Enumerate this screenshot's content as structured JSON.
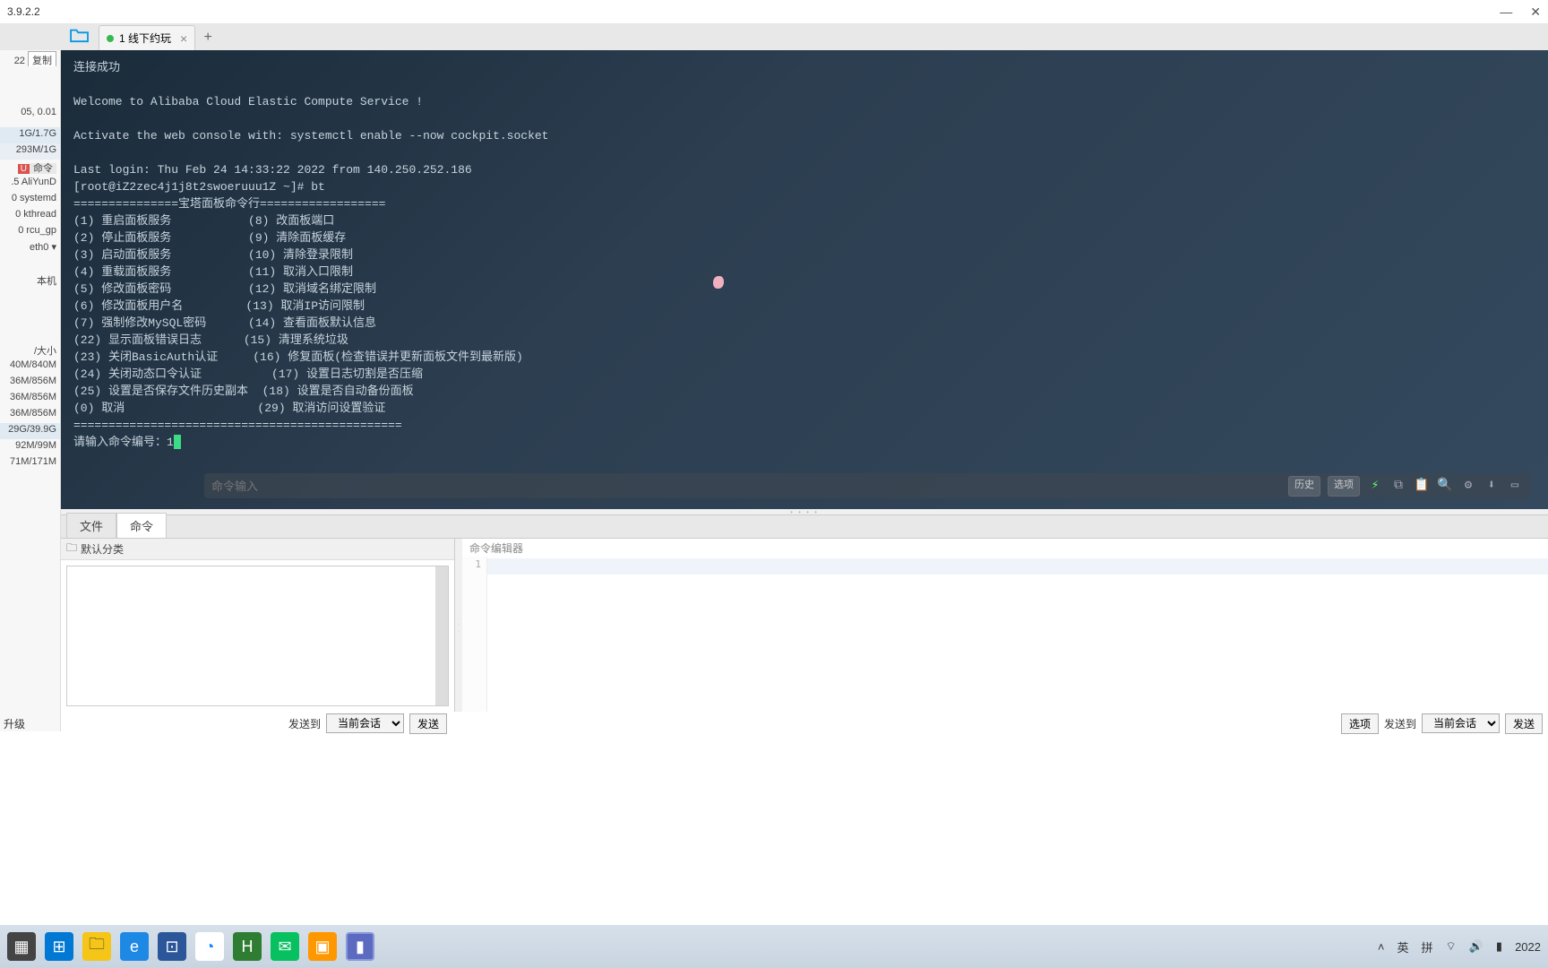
{
  "title_bar": {
    "version": "3.9.2.2"
  },
  "window_controls": {
    "min": "—",
    "close": "✕"
  },
  "tab": {
    "label": "1 线下约玩",
    "close": "×",
    "new": "+"
  },
  "side": {
    "num22": "22",
    "copy": "复制",
    "load": "05, 0.01",
    "mem1": "1G/1.7G",
    "mem2": "293M/1G",
    "cmd_badge": "U",
    "cmd_text": "命令",
    "p1": ".5 AliYunD",
    "p2": "0 systemd",
    "p3": "0 kthread",
    "p4": "0 rcu_gp",
    "iface": "eth0 ▾",
    "local": "本机",
    "sizes_hdr": "/大小",
    "s1": "40M/840M",
    "s2": "36M/856M",
    "s3": "36M/856M",
    "s4": "36M/856M",
    "s5": "29G/39.9G",
    "s6": "92M/99M",
    "s7": "71M/171M",
    "upgrade": "升级"
  },
  "terminal": {
    "lines": "连接成功\n\nWelcome to Alibaba Cloud Elastic Compute Service !\n\nActivate the web console with: systemctl enable --now cockpit.socket\n\nLast login: Thu Feb 24 14:33:22 2022 from 140.250.252.186\n[root@iZ2zec4j1j8t2swoeruuu1Z ~]# bt\n===============宝塔面板命令行==================\n(1) 重启面板服务           (8) 改面板端口\n(2) 停止面板服务           (9) 清除面板缓存\n(3) 启动面板服务           (10) 清除登录限制\n(4) 重载面板服务           (11) 取消入口限制\n(5) 修改面板密码           (12) 取消域名绑定限制\n(6) 修改面板用户名         (13) 取消IP访问限制\n(7) 强制修改MySQL密码      (14) 查看面板默认信息\n(22) 显示面板错误日志      (15) 清理系统垃圾\n(23) 关闭BasicAuth认证     (16) 修复面板(检查错误并更新面板文件到最新版)\n(24) 关闭动态口令认证          (17) 设置日志切割是否压缩\n(25) 设置是否保存文件历史副本  (18) 设置是否自动备份面板\n(0) 取消                   (29) 取消访问设置验证\n===============================================\n请输入命令编号：1",
    "input_placeholder": "命令输入",
    "history": "历史",
    "options": "选项"
  },
  "bottom_tabs": {
    "file": "文件",
    "cmd": "命令"
  },
  "category": {
    "default": "默认分类"
  },
  "editor": {
    "title": "命令编辑器",
    "line1": "1"
  },
  "send": {
    "send_to": "发送到",
    "current_session": "当前会话",
    "send": "发送",
    "options": "选项"
  },
  "taskbar": {
    "tray": {
      "lang1": "英",
      "lang2": "拼",
      "date": "2022"
    }
  }
}
